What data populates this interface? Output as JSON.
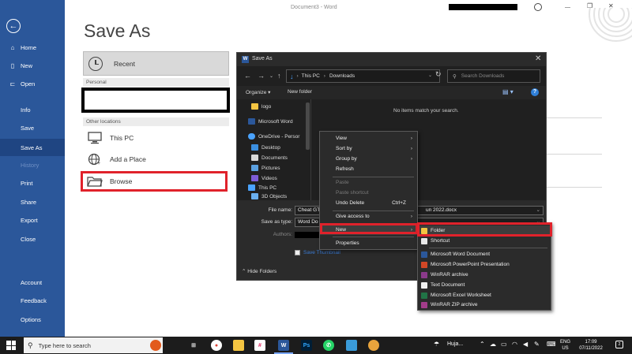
{
  "word": {
    "title": "Document3  -  Word",
    "page_title": "Save As",
    "sidebar": {
      "items": [
        {
          "label": "Home",
          "icon": "home-icon"
        },
        {
          "label": "New",
          "icon": "new-document-icon"
        },
        {
          "label": "Open",
          "icon": "folder-open-icon"
        },
        {
          "label": "Info"
        },
        {
          "label": "Save"
        },
        {
          "label": "Save As",
          "active": true
        },
        {
          "label": "History",
          "disabled": true
        },
        {
          "label": "Print"
        },
        {
          "label": "Share"
        },
        {
          "label": "Export"
        },
        {
          "label": "Close"
        },
        {
          "label": "Account"
        },
        {
          "label": "Feedback"
        },
        {
          "label": "Options"
        }
      ]
    },
    "recent_label": "Recent",
    "personal_label": "Personal",
    "other_locations_label": "Other locations",
    "locations": [
      "This PC",
      "Add a Place",
      "Browse"
    ]
  },
  "dialog": {
    "title": "Save As",
    "breadcrumb": [
      "This PC",
      "Downloads"
    ],
    "search_placeholder": "Search Downloads",
    "organize_label": "Organize ▾",
    "new_folder_label": "New folder",
    "nav_items": [
      {
        "label": "logo"
      },
      {
        "label": "Microsoft Word"
      },
      {
        "label": "OneDrive - Persor"
      },
      {
        "label": "Desktop"
      },
      {
        "label": "Documents"
      },
      {
        "label": "Pictures"
      },
      {
        "label": "Videos"
      },
      {
        "label": "This PC"
      },
      {
        "label": "3D Objects"
      }
    ],
    "empty_message": "No items match your search.",
    "file_name_label": "File name:",
    "file_name_value": "Cheat GT",
    "file_name_tail": "un 2022.docx",
    "save_as_type_label": "Save as type:",
    "save_as_type_value": "Word Do",
    "authors_label": "Authors:",
    "thumbnail_label": "Save Thumbnail",
    "hide_folders_label": "Hide Folders"
  },
  "context_menu": {
    "items": [
      {
        "label": "View",
        "submenu": true
      },
      {
        "label": "Sort by",
        "submenu": true
      },
      {
        "label": "Group by",
        "submenu": true
      },
      {
        "label": "Refresh"
      },
      {
        "label": "Paste",
        "disabled": true
      },
      {
        "label": "Paste shortcut",
        "disabled": true
      },
      {
        "label": "Undo Delete",
        "shortcut": "Ctrl+Z"
      },
      {
        "label": "Give access to",
        "submenu": true
      },
      {
        "label": "New",
        "submenu": true,
        "highlighted": true
      },
      {
        "label": "Properties"
      }
    ]
  },
  "new_submenu": {
    "items": [
      {
        "label": "Folder",
        "icon": "folder-icon",
        "color": "#f4c542"
      },
      {
        "label": "Shortcut",
        "icon": "shortcut-icon",
        "color": "#e8e8e8"
      },
      {
        "label": "Microsoft Word Document",
        "icon": "word-doc-icon",
        "color": "#2b579a"
      },
      {
        "label": "Microsoft PowerPoint Presentation",
        "icon": "powerpoint-icon",
        "color": "#d24726"
      },
      {
        "label": "WinRAR archive",
        "icon": "winrar-icon",
        "color": "#8b3a8b"
      },
      {
        "label": "Text Document",
        "icon": "text-doc-icon",
        "color": "#f0f0f0"
      },
      {
        "label": "Microsoft Excel Worksheet",
        "icon": "excel-icon",
        "color": "#217346"
      },
      {
        "label": "WinRAR ZIP archive",
        "icon": "winrar-zip-icon",
        "color": "#a33c8a"
      }
    ]
  },
  "taskbar": {
    "search_placeholder": "Type here to search",
    "weather": "Huja...",
    "lang_line1": "ENG",
    "lang_line2": "US",
    "time": "17:09",
    "date": "07/11/2022",
    "notifications": "2"
  },
  "colors": {
    "word_blue": "#2b579a",
    "highlight_red": "#e0222b",
    "dialog_bg": "#202020"
  }
}
